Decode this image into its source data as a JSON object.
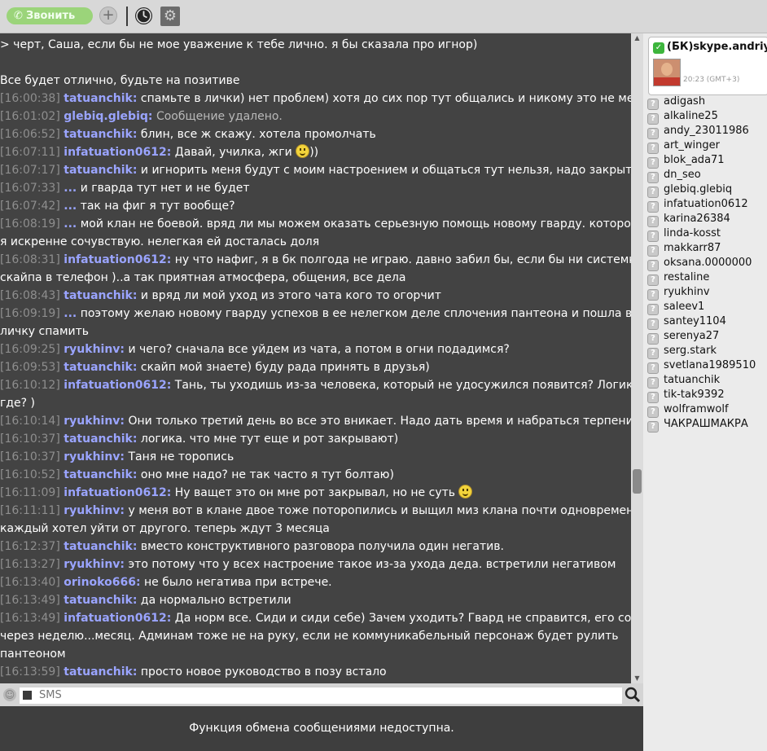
{
  "toolbar": {
    "call_label": "Звонить",
    "add_glyph": "+",
    "icons": [
      "phone-icon",
      "add-icon",
      "history-clock-icon",
      "settings-gear-icon"
    ]
  },
  "messages": [
    {
      "ts": "",
      "nick": "",
      "text": "> черт, Саша, если бы не мое уважение к тебе лично. я бы сказала про игнор)"
    },
    {
      "ts": "",
      "nick": "",
      "text": "Все будет отлично, будьте на позитиве"
    },
    {
      "ts": "[16:00:38]",
      "nick": "tatuanchik:",
      "text": "спамьте в лички) нет проблем) хотя до сих пор тут общались и никому это не мешало"
    },
    {
      "ts": "[16:01:02]",
      "nick": "glebiq.glebiq:",
      "text": "Сообщение удалено.",
      "deleted": true
    },
    {
      "ts": "[16:06:52]",
      "nick": "tatuanchik:",
      "text": "блин, все ж скажу. хотела промолчать"
    },
    {
      "ts": "[16:07:11]",
      "nick": "infatuation0612:",
      "text": "Давай, училка, жги",
      "smile": true,
      "after": "))"
    },
    {
      "ts": "[16:07:17]",
      "nick": "tatuanchik:",
      "text": " и игнорить меня будут с моим настроением и общаться тут нельзя, надо закрыть рот"
    },
    {
      "ts": "[16:07:33]",
      "nick": "...",
      "text": "и гварда тут нет и не будет"
    },
    {
      "ts": "[16:07:42]",
      "nick": "...",
      "text": "так на фиг я тут вообще?"
    },
    {
      "ts": "[16:08:19]",
      "nick": "...",
      "text": " мой клан не боевой. вряд ли мы можем оказать серьезную помощь новому гварду. которому"
    },
    {
      "ts": "",
      "nick": "",
      "text": "я искренне сочувствую. нелегкая ей досталась доля"
    },
    {
      "ts": "[16:08:31]",
      "nick": "infatuation0612:",
      "text": "ну что нафиг, я в бк полгода не играю. давно забил бы, если бы ни системки из"
    },
    {
      "ts": "",
      "nick": "",
      "text": "скайпа в телефон )..а так приятная атмосфера, общения, все дела"
    },
    {
      "ts": "[16:08:43]",
      "nick": "tatuanchik:",
      "text": " и вряд ли мой уход из этого чата кого то огорчит"
    },
    {
      "ts": "[16:09:19]",
      "nick": "...",
      "text": "поэтому желаю новому гварду успехов в ее нелегком деле сплочения пантеона и пошла в"
    },
    {
      "ts": "",
      "nick": "",
      "text": "личку спамить"
    },
    {
      "ts": "[16:09:25]",
      "nick": "ryukhinv:",
      "text": "и чего? сначала все уйдем из чата, а потом в огни подадимся?"
    },
    {
      "ts": "[16:09:53]",
      "nick": "tatuanchik:",
      "text": "скайп мой знаете) буду рада принять в друзья)"
    },
    {
      "ts": "[16:10:12]",
      "nick": "infatuation0612:",
      "text": "Тань, ты уходишь из-за человека, который не удосужился появится? Логика"
    },
    {
      "ts": "",
      "nick": "",
      "text": "где? )"
    },
    {
      "ts": "[16:10:14]",
      "nick": "ryukhinv:",
      "text": "Они только третий день во все это вникает. Надо дать время и набраться терпения",
      "smile": true
    },
    {
      "ts": "[16:10:37]",
      "nick": "tatuanchik:",
      "text": "логика. что мне тут еще и рот закрывают)"
    },
    {
      "ts": "[16:10:37]",
      "nick": "ryukhinv:",
      "text": "Таня не торопись"
    },
    {
      "ts": "[16:10:52]",
      "nick": "tatuanchik:",
      "text": "оно мне надо? не так часто я тут болтаю)"
    },
    {
      "ts": "[16:11:09]",
      "nick": "infatuation0612:",
      "text": "Ну ващет это он мне рот закрывал, но не суть",
      "smile": true
    },
    {
      "ts": "[16:11:11]",
      "nick": "ryukhinv:",
      "text": "у меня вот в клане двое тоже поторопились и выщил миз клана почти одновременно"
    },
    {
      "ts": "",
      "nick": "",
      "text": "каждый хотел уйти от другого. теперь ждут 3 месяца"
    },
    {
      "ts": "[16:12:37]",
      "nick": "tatuanchik:",
      "text": "вместо конструктивного разговора получила один негатив."
    },
    {
      "ts": "[16:13:27]",
      "nick": "ryukhinv:",
      "text": "это потому что у всех настроение такое из-за ухода деда. встретили негативом"
    },
    {
      "ts": "[16:13:40]",
      "nick": "orinoko666:",
      "text": "не было негатива при встрече."
    },
    {
      "ts": "[16:13:49]",
      "nick": "tatuanchik:",
      "text": "да нормально встретили"
    },
    {
      "ts": "[16:13:49]",
      "nick": "infatuation0612:",
      "text": "Да норм все. Сиди и сиди себе) Зачем уходить? Гвард не справится, его сольют"
    },
    {
      "ts": "",
      "nick": "",
      "text": "через неделю...месяц. Админам тоже не на руку, если не коммуникабельный персонаж будет рулить"
    },
    {
      "ts": "",
      "nick": "",
      "text": "пантеоном"
    },
    {
      "ts": "[16:13:59]",
      "nick": "tatuanchik:",
      "text": "просто новое руководство в позу встало"
    }
  ],
  "profile": {
    "name": "(БК)skype.andriy",
    "time": "20:23 (GMT+3)",
    "status_color": "#3db53d"
  },
  "contacts": [
    "adigash",
    "alkaline25",
    "andy_23011986",
    "art_winger",
    "blok_ada71",
    "dn_seo",
    "glebiq.glebiq",
    "infatuation0612",
    "karina26384",
    "linda-kosst",
    "makkarr87",
    "oksana.0000000",
    "restaline",
    "ryukhinv",
    "saleev1",
    "santey1104",
    "serenya27",
    "serg.stark",
    "svetlana1989510",
    "tatuanchik",
    "tik-tak9392",
    "wolframwolf",
    "ЧАКРАШМАКРА"
  ],
  "input": {
    "placeholder": "SMS"
  },
  "footer": {
    "notice": "Функция обмена сообщениями недоступна."
  },
  "colors": {
    "nick": "#9aa4ff",
    "timestamp": "#8e8e8e",
    "chat_bg": "#434343",
    "call_button": "#9bd47a"
  }
}
